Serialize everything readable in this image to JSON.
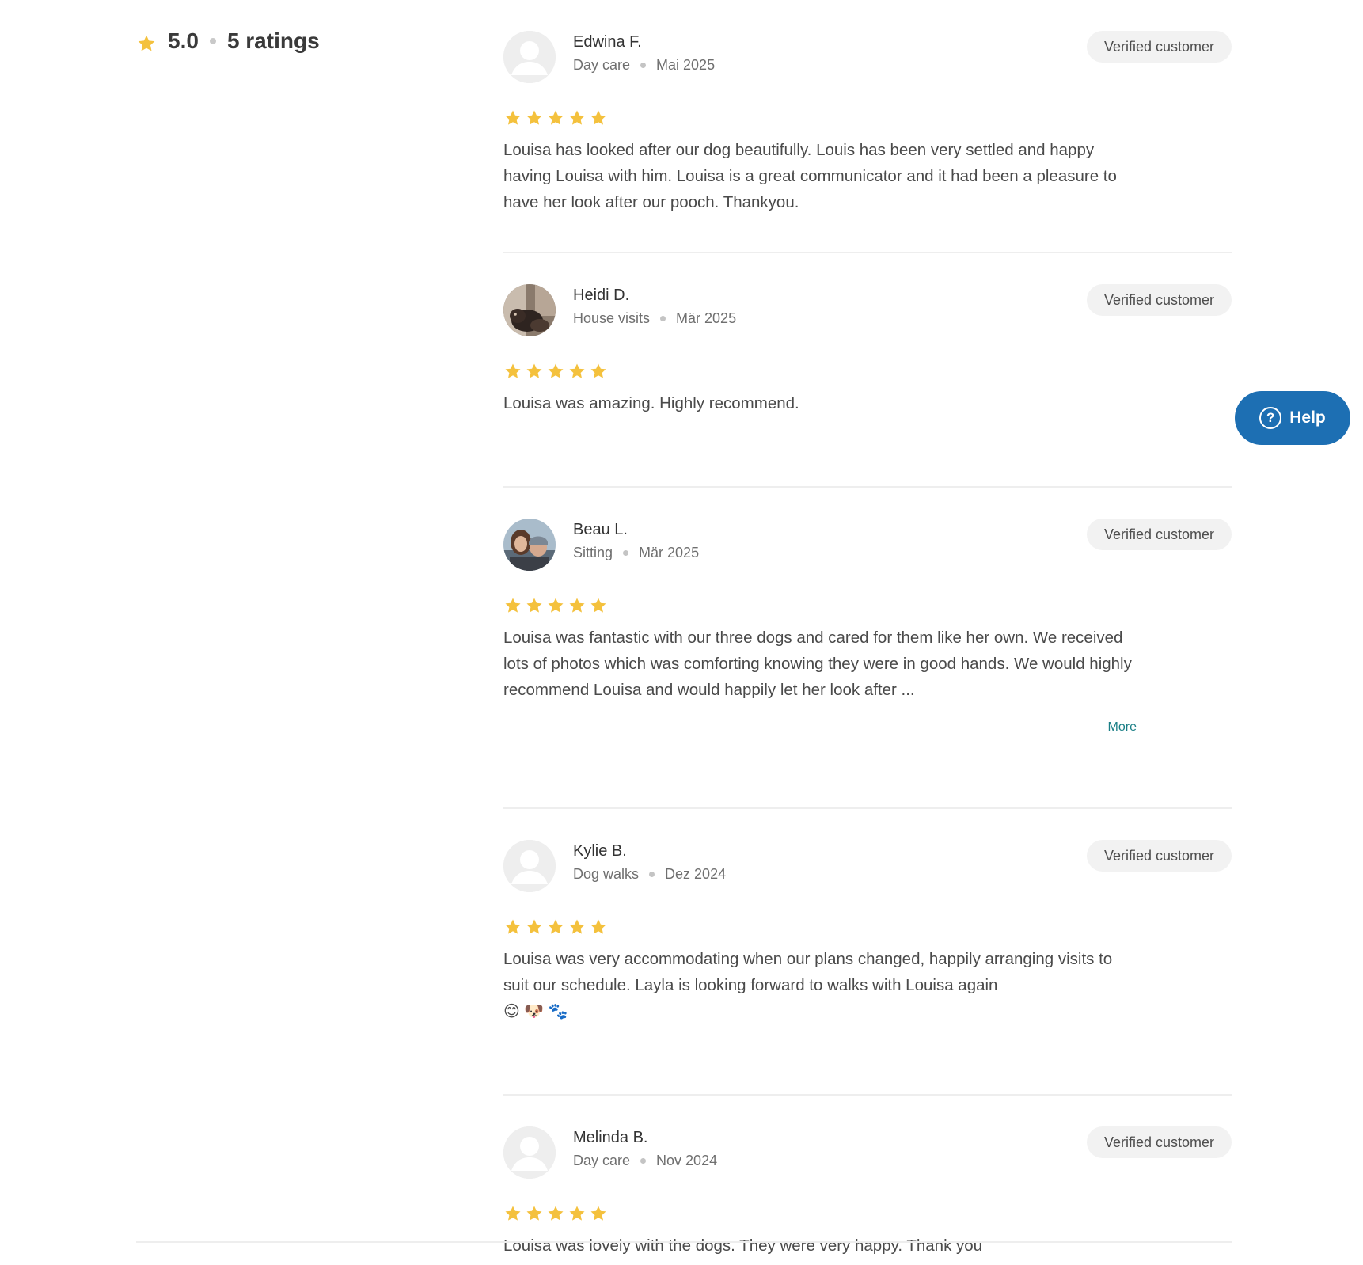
{
  "summary": {
    "rating": "5.0",
    "ratings_label": "5 ratings",
    "icon": "star-icon"
  },
  "colors": {
    "star": "#f4c13d",
    "help_button": "#1d6fb3",
    "more_link": "#1a7f86",
    "badge_bg": "#f2f2f2"
  },
  "reviews": [
    {
      "name": "Edwina F.",
      "service": "Day care",
      "date": "Mai 2025",
      "badge": "Verified customer",
      "stars": 5,
      "avatar": "default-avatar-icon",
      "text": "Louisa has looked after our dog beautifully. Louis has been very settled and happy having Louisa with him. Louisa is a great communicator and it had been a pleasure to have her look after our pooch. Thankyou."
    },
    {
      "name": "Heidi D.",
      "service": "House visits",
      "date": "Mär 2025",
      "badge": "Verified customer",
      "stars": 5,
      "avatar": "photo-avatar-dog",
      "text": "Louisa was amazing. Highly recommend."
    },
    {
      "name": "Beau L.",
      "service": "Sitting",
      "date": "Mär 2025",
      "badge": "Verified customer",
      "stars": 5,
      "avatar": "photo-avatar-people",
      "text": "Louisa was fantastic with our three dogs and cared for them like her own. We received lots of photos which was comforting knowing they were in good hands. We would highly recommend Louisa and would happily let her look after ...",
      "more": "More"
    },
    {
      "name": "Kylie B.",
      "service": "Dog walks",
      "date": "Dez 2024",
      "badge": "Verified customer",
      "stars": 5,
      "avatar": "default-avatar-icon",
      "text": "Louisa was very accommodating when our plans changed, happily arranging visits to suit our schedule. Layla is looking forward to walks with Louisa again",
      "emojis": "😊 🐶 🐾"
    },
    {
      "name": "Melinda B.",
      "service": "Day care",
      "date": "Nov 2024",
      "badge": "Verified customer",
      "stars": 5,
      "avatar": "default-avatar-icon",
      "text": "Louisa was lovely with the dogs. They were very happy. Thank you"
    }
  ],
  "help": {
    "label": "Help",
    "icon": "question-circle-icon",
    "glyph": "?"
  }
}
